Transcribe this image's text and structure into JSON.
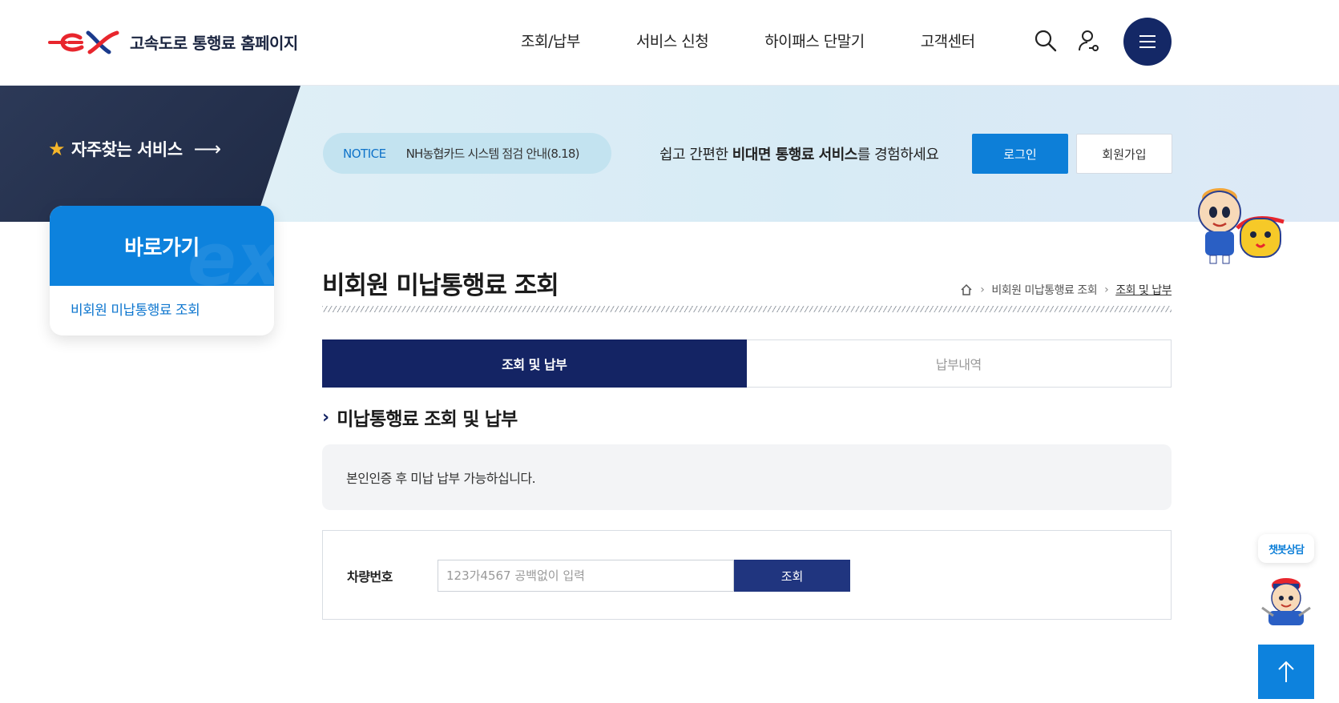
{
  "header": {
    "logo_text": "고속도로 통행료 홈페이지",
    "nav": [
      "조회/납부",
      "서비스 신청",
      "하이패스 단말기",
      "고객센터"
    ]
  },
  "banner": {
    "favorites_label": "자주찾는 서비스",
    "notice_tag": "NOTICE",
    "notice_text": "NH농협카드 시스템 점검 안내(8.18)",
    "promo_prefix": "쉽고 간편한 ",
    "promo_bold": "비대면 통행료 서비스",
    "promo_suffix": "를 경험하세요",
    "login_label": "로그인",
    "join_label": "회원가입"
  },
  "quick": {
    "title": "바로가기",
    "items": [
      "비회원 미납통행료 조회"
    ]
  },
  "page": {
    "title": "비회원 미납통행료 조회",
    "breadcrumb": [
      "비회원 미납통행료 조회",
      "조회 및 납부"
    ]
  },
  "tabs": [
    {
      "label": "조회 및 납부",
      "active": true
    },
    {
      "label": "납부내역",
      "active": false
    }
  ],
  "section": {
    "title": "미납통행료 조회 및 납부",
    "info_text": "본인인증 후 미납 납부 가능하십니다."
  },
  "search": {
    "label": "차량번호",
    "value": "",
    "placeholder": "123가4567 공백없이 입력",
    "button_label": "조회"
  },
  "chatbot": {
    "label": "챗봇상담"
  },
  "colors": {
    "navy": "#142464",
    "blue": "#0d82dd",
    "brand_red": "#e8262d"
  }
}
